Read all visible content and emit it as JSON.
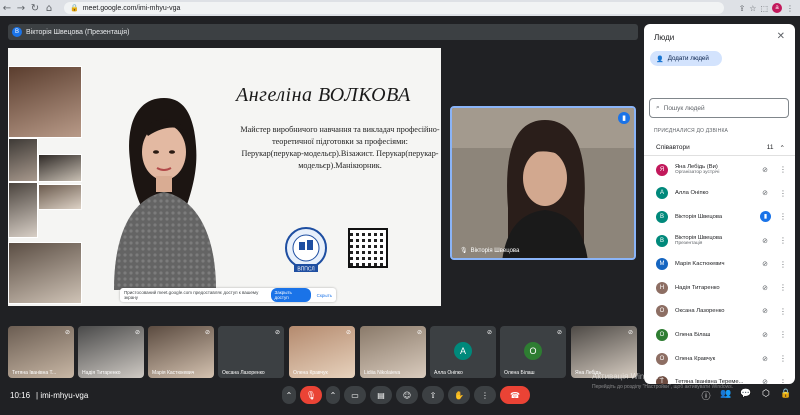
{
  "browser": {
    "url": "meet.google.com/imi-mhyu-vga",
    "profile_initial": "a"
  },
  "presenter": {
    "initial": "В",
    "label": "Вікторія Швецова (Презентація)"
  },
  "slide": {
    "name": "Ангеліна ВОЛКОВА",
    "description": "Майстер виробничого навчання та викладач професійно-теоретичної підготовки за професіями: Перукар(перукар-модельєр).Візажист. Перукар(перукар-модельєр).Манікюрник.",
    "logo_text": "ВППСЛ",
    "share_notice": "Пристосований meet.google.com предоставляє доступ к вашему экрану",
    "share_stop": "Закрыть доступ",
    "share_hide": "Скрыть"
  },
  "speaker": {
    "name": "Вікторія Швецова"
  },
  "people_panel": {
    "title": "Люди",
    "add_button": "Додати людей",
    "search_placeholder": "Пошук людей",
    "joined_label": "ПРИЄДНАЛИСЯ ДО ДЗВІНКА",
    "group_label": "Співавтори",
    "group_count": "11",
    "participants": [
      {
        "initial": "Я",
        "name": "Яна Лебідь (Ви)",
        "role": "Організатор зустрічі",
        "color": "#c2185b",
        "mic": "muted"
      },
      {
        "initial": "А",
        "name": "Алла Онiпко",
        "role": "",
        "color": "#00897b",
        "mic": "muted"
      },
      {
        "initial": "В",
        "name": "Вікторія Швецова",
        "role": "",
        "color": "#00897b",
        "mic": "speaking"
      },
      {
        "initial": "В",
        "name": "Вікторія Швецова",
        "role": "Презентація",
        "color": "#00897b",
        "mic": "muted"
      },
      {
        "initial": "М",
        "name": "Марія Kaстюкевич",
        "role": "",
        "color": "#1565c0",
        "mic": "muted"
      },
      {
        "initial": "Н",
        "name": "Надія Титаренко",
        "role": "",
        "color": "#8d6e63",
        "mic": "muted"
      },
      {
        "initial": "О",
        "name": "Оксана Лазоренко",
        "role": "",
        "color": "#8d6e63",
        "mic": "muted"
      },
      {
        "initial": "О",
        "name": "Олена Білаш",
        "role": "",
        "color": "#2e7d32",
        "mic": "muted"
      },
      {
        "initial": "О",
        "name": "Олена Кравчук",
        "role": "",
        "color": "#8d6e63",
        "mic": "muted"
      },
      {
        "initial": "Т",
        "name": "Тетяна Іванівна Тереме...",
        "role": "",
        "color": "#6d4c41",
        "mic": "muted"
      }
    ]
  },
  "filmstrip": [
    {
      "name": "Тетяна Іванівна Т...",
      "initial": "",
      "color": "",
      "photo": true
    },
    {
      "name": "Надія Титаренко",
      "initial": "",
      "color": "",
      "photo": true
    },
    {
      "name": "Марія Кастюкевич",
      "initial": "",
      "color": "",
      "photo": true
    },
    {
      "name": "Оксана Лазоренко",
      "initial": "",
      "color": "",
      "photo": true
    },
    {
      "name": "Олена Кравчук",
      "initial": "",
      "color": "",
      "photo": true
    },
    {
      "name": "Lidiia Nikolaieva",
      "initial": "",
      "color": "",
      "photo": true
    },
    {
      "name": "Алла Онiпко",
      "initial": "А",
      "color": "#00897b",
      "photo": false
    },
    {
      "name": "Олена Білаш",
      "initial": "О",
      "color": "#2e7d32",
      "photo": false
    },
    {
      "name": "Яна Лебідь",
      "initial": "",
      "color": "",
      "photo": true
    }
  ],
  "windows_watermark": {
    "title": "Активація Windows",
    "subtitle": "Перейдіть до розділу \"Настройки\", щоб активувати Windows."
  },
  "bottom_bar": {
    "time": "10:16",
    "meeting_code": "imi-mhyu-vga"
  }
}
